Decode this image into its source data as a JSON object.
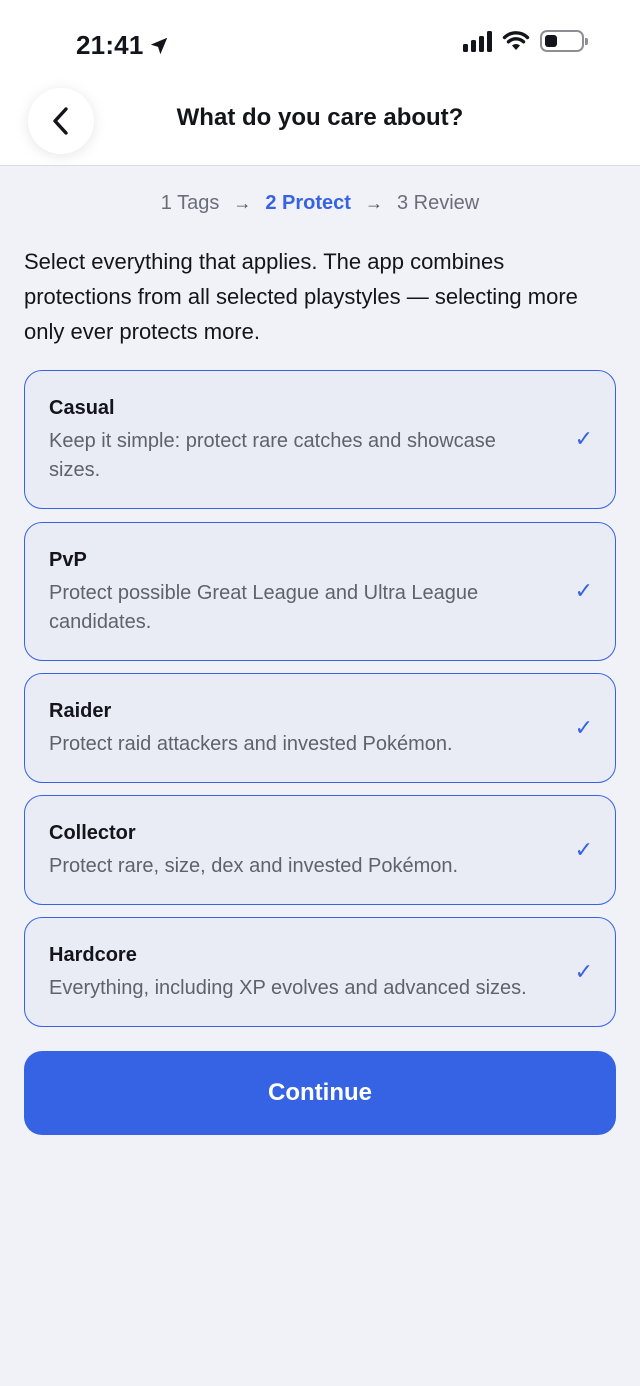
{
  "status_bar": {
    "time": "21:41"
  },
  "header": {
    "title": "What do you care about?"
  },
  "steps": [
    {
      "label": "1 Tags",
      "active": false
    },
    {
      "label": "2 Protect",
      "active": true
    },
    {
      "label": "3 Review",
      "active": false
    }
  ],
  "intro": "Select everything that applies. The app combines protections from all selected playstyles — selecting more only ever protects more.",
  "options": [
    {
      "title": "Casual",
      "description": "Keep it simple: protect rare catches and showcase sizes.",
      "selected": true
    },
    {
      "title": "PvP",
      "description": "Protect possible Great League and Ultra League candidates.",
      "selected": true
    },
    {
      "title": "Raider",
      "description": "Protect raid attackers and invested Pokémon.",
      "selected": true
    },
    {
      "title": "Collector",
      "description": "Protect rare, size, dex and invested Pokémon.",
      "selected": true
    },
    {
      "title": "Hardcore",
      "description": "Everything, including XP evolves and advanced sizes.",
      "selected": true
    }
  ],
  "check_glyph": "✓",
  "continue_label": "Continue",
  "colors": {
    "accent": "#3563e4",
    "card_bg": "#e9ebf5",
    "page_bg": "#f1f2f7"
  },
  "icons": {
    "back": "chevron-left-icon",
    "location": "location-arrow-icon",
    "signal": "cellular-signal-icon",
    "wifi": "wifi-icon",
    "battery": "battery-icon",
    "check": "checkmark-icon"
  }
}
